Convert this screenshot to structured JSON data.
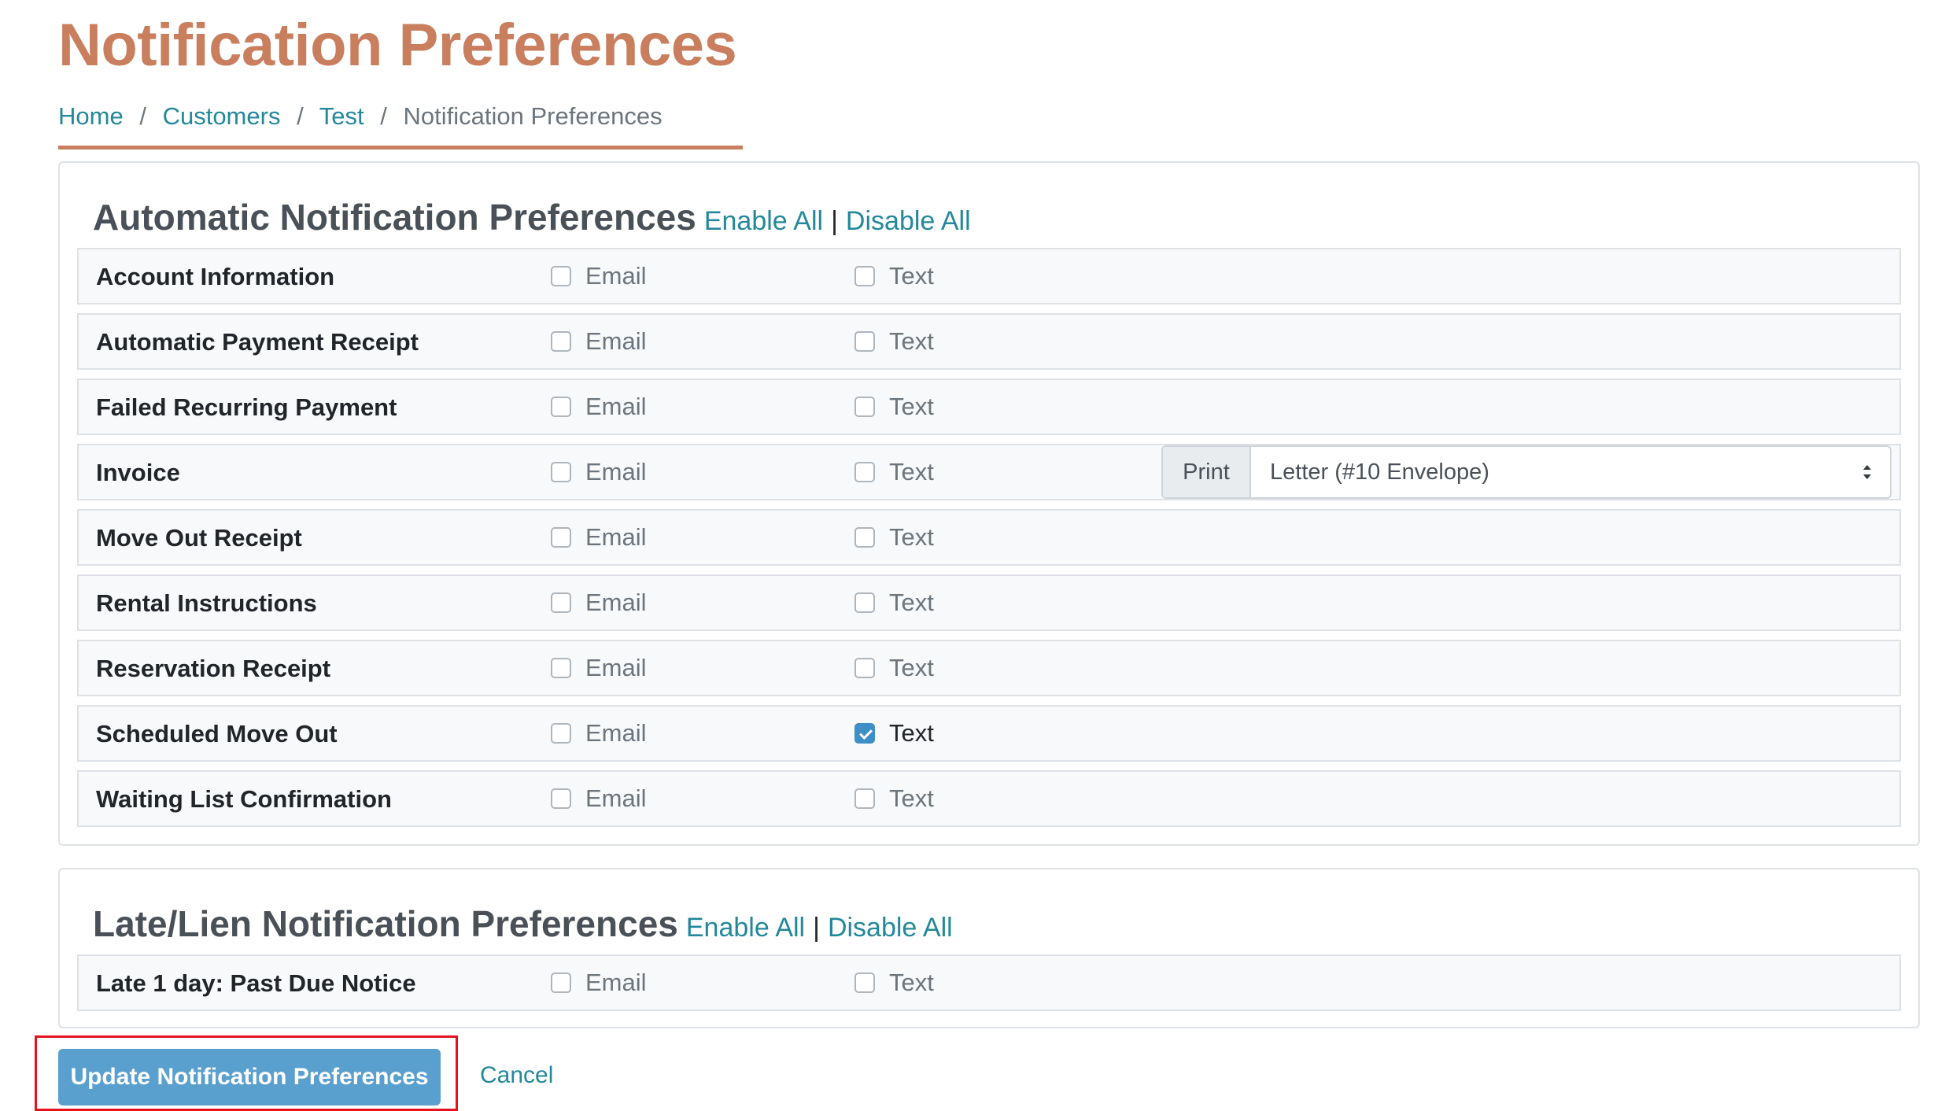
{
  "page": {
    "title": "Notification Preferences"
  },
  "breadcrumb": {
    "items": [
      "Home",
      "Customers",
      "Test"
    ],
    "current": "Notification Preferences",
    "separator": "/"
  },
  "automatic": {
    "title": "Automatic Notification Preferences",
    "enable_all": "Enable All",
    "pipe": "|",
    "disable_all": "Disable All",
    "rows": [
      {
        "label": "Account Information",
        "email": false,
        "text": false
      },
      {
        "label": "Automatic Payment Receipt",
        "email": false,
        "text": false
      },
      {
        "label": "Failed Recurring Payment",
        "email": false,
        "text": false
      },
      {
        "label": "Invoice",
        "email": false,
        "text": false
      },
      {
        "label": "Move Out Receipt",
        "email": false,
        "text": false
      },
      {
        "label": "Rental Instructions",
        "email": false,
        "text": false
      },
      {
        "label": "Reservation Receipt",
        "email": false,
        "text": false
      },
      {
        "label": "Scheduled Move Out",
        "email": false,
        "text": true
      },
      {
        "label": "Waiting List Confirmation",
        "email": false,
        "text": false
      }
    ]
  },
  "late_lien": {
    "title": "Late/Lien Notification Preferences",
    "enable_all": "Enable All",
    "pipe": "|",
    "disable_all": "Disable All",
    "rows": [
      {
        "label": "Late 1 day: Past Due Notice",
        "email": false,
        "text": false
      }
    ]
  },
  "options": {
    "email_label": "Email",
    "text_label": "Text"
  },
  "invoice_print": {
    "addon": "Print",
    "selected": "Letter (#10 Envelope)"
  },
  "actions": {
    "update": "Update Notification Preferences",
    "cancel": "Cancel"
  },
  "colors": {
    "title": "#c97e5e",
    "link": "#23889a",
    "primary_button": "#5aa0cf",
    "checkbox_checked": "#3d8fc6",
    "highlight_border": "#e3121d"
  }
}
